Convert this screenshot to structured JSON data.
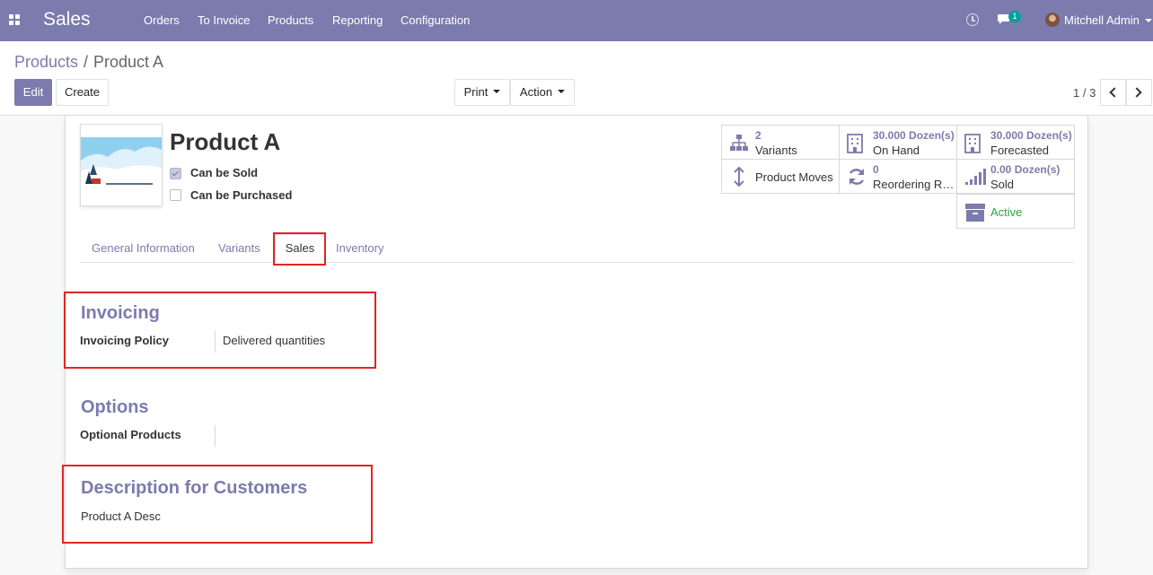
{
  "navbar": {
    "brand": "Sales",
    "menu": [
      "Orders",
      "To Invoice",
      "Products",
      "Reporting",
      "Configuration"
    ],
    "chat_badge": "1",
    "user_name": "Mitchell Admin"
  },
  "breadcrumb": {
    "parent": "Products",
    "separator": "/",
    "current": "Product A"
  },
  "buttons": {
    "edit": "Edit",
    "create": "Create",
    "print": "Print",
    "action": "Action"
  },
  "pager": {
    "value": "1 / 3"
  },
  "product": {
    "name": "Product A",
    "can_be_sold_label": "Can be Sold",
    "can_be_sold": true,
    "can_be_purchased_label": "Can be Purchased",
    "can_be_purchased": false
  },
  "smart_buttons": {
    "variants": {
      "value": "2",
      "label": "Variants"
    },
    "on_hand": {
      "value": "30.000",
      "unit": "Dozen(s)",
      "label": "On Hand"
    },
    "forecasted": {
      "value": "30.000",
      "unit": "Dozen(s)",
      "label": "Forecasted"
    },
    "product_moves": {
      "label": "Product Moves"
    },
    "reordering": {
      "value": "0",
      "label": "Reordering R…"
    },
    "sold": {
      "value": "0.00",
      "unit": "Dozen(s)",
      "label": "Sold"
    },
    "active": {
      "label": "Active",
      "color": "#28a745"
    }
  },
  "tabs": [
    "General Information",
    "Variants",
    "Sales",
    "Inventory"
  ],
  "active_tab": "Sales",
  "sections": {
    "invoicing": {
      "title": "Invoicing",
      "policy_label": "Invoicing Policy",
      "policy_value": "Delivered quantities"
    },
    "options": {
      "title": "Options",
      "optional_products_label": "Optional Products"
    },
    "description": {
      "title": "Description for Customers",
      "value": "Product A Desc"
    }
  },
  "colors": {
    "brand": "#7c7bad",
    "highlight": "#e32424",
    "badge": "#00a09d"
  }
}
